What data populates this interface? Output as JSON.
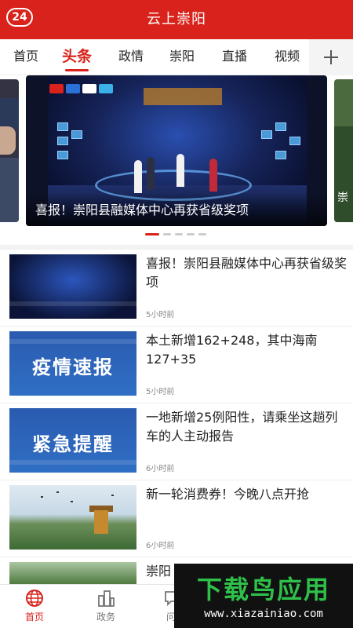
{
  "header": {
    "badge": "24",
    "title": "云上崇阳"
  },
  "tabs": [
    {
      "label": "首页"
    },
    {
      "label": "头条",
      "active": true
    },
    {
      "label": "政情"
    },
    {
      "label": "崇阳"
    },
    {
      "label": "直播"
    },
    {
      "label": "视频"
    }
  ],
  "add_tab_icon": "plus-icon",
  "carousel": {
    "caption": "喜报！崇阳县融媒体中心再获省级奖项",
    "right_card_glyph": "崇",
    "page_count": 5,
    "active_index": 0
  },
  "news": [
    {
      "title": "喜报！崇阳县融媒体中心再获省级奖项",
      "time": "5小时前",
      "thumb": "stage"
    },
    {
      "title": "本土新增162+248，其中海南127+35",
      "time": "5小时前",
      "thumb": "blue",
      "thumb_text": "疫情速报"
    },
    {
      "title": "一地新增25例阳性，请乘坐这趟列车的人主动报告",
      "time": "6小时前",
      "thumb": "blue",
      "thumb_text": "紧急提醒"
    },
    {
      "title": "新一轮消费券！今晚八点开抢",
      "time": "6小时前",
      "thumb": "landscape"
    },
    {
      "title": "崇阳",
      "time": "",
      "thumb": "trees"
    }
  ],
  "bottom_nav": [
    {
      "label": "首页",
      "icon": "globe-icon",
      "active": true
    },
    {
      "label": "政务",
      "icon": "building-icon"
    },
    {
      "label": "问",
      "icon": "question-icon"
    }
  ],
  "colors": {
    "accent": "#d8221b",
    "watermark_green": "#2fc04a"
  },
  "watermark": {
    "title": "下载鸟应用",
    "url": "www.xiazainiao.com"
  }
}
